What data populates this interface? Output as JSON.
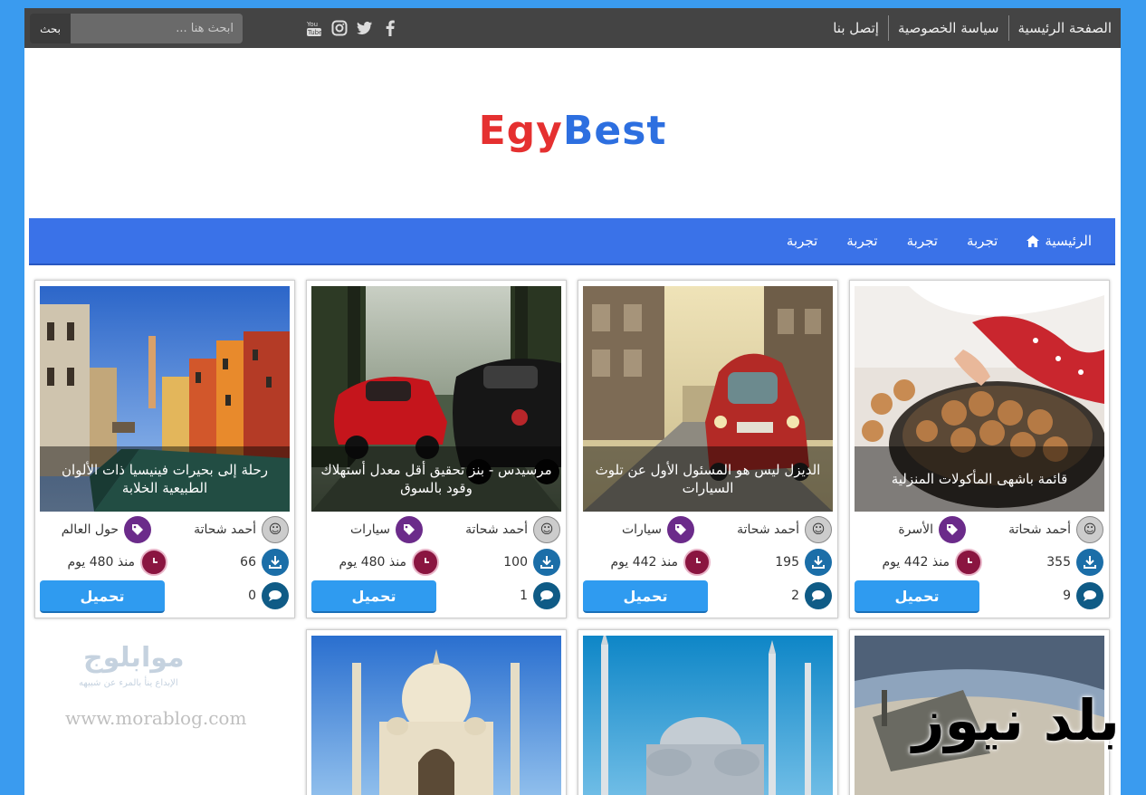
{
  "topbar": {
    "links": [
      "الصفحة الرئيسية",
      "سياسة الخصوصية",
      "إتصل بنا"
    ],
    "search_placeholder": "ابحث هنا ...",
    "search_button": "بحث",
    "socials": [
      "facebook-icon",
      "twitter-icon",
      "instagram-icon",
      "youtube-icon"
    ]
  },
  "logo": {
    "part1": "Egy",
    "part2": "Best"
  },
  "nav": {
    "home": "الرئيسية",
    "items": [
      "تجربة",
      "تجربة",
      "تجربة",
      "تجربة"
    ]
  },
  "cards": [
    {
      "title": "قائمة باشهى المأكولات المنزلية",
      "author": "أحمد شحاتة",
      "category": "الأسرة",
      "downloads": "355",
      "time": "منذ 442 يوم",
      "comments": "9",
      "button": "تحميل"
    },
    {
      "title": "الديزل ليس هو المسئول الأول عن تلوث السيارات",
      "author": "أحمد شحاتة",
      "category": "سيارات",
      "downloads": "195",
      "time": "منذ 442 يوم",
      "comments": "2",
      "button": "تحميل"
    },
    {
      "title": "مرسيدس - بنز تحقيق أقل معدل أستهلاك وقود بالسوق",
      "author": "أحمد شحاتة",
      "category": "سيارات",
      "downloads": "100",
      "time": "منذ 480 يوم",
      "comments": "1",
      "button": "تحميل"
    },
    {
      "title": "رحلة إلى بحيرات فينيسيا ذات الألوان الطبيعية الخلابة",
      "author": "أحمد شحاتة",
      "category": "حول العالم",
      "downloads": "66",
      "time": "منذ 480 يوم",
      "comments": "0",
      "button": "تحميل"
    }
  ],
  "watermarks": {
    "morablog_name": "موابلوج",
    "morablog_tagline": "الإبداع ينأ بالمرء عن شبيهه",
    "morablog_url": "www.morablog.com",
    "baladnews": "بلد نيوز"
  }
}
